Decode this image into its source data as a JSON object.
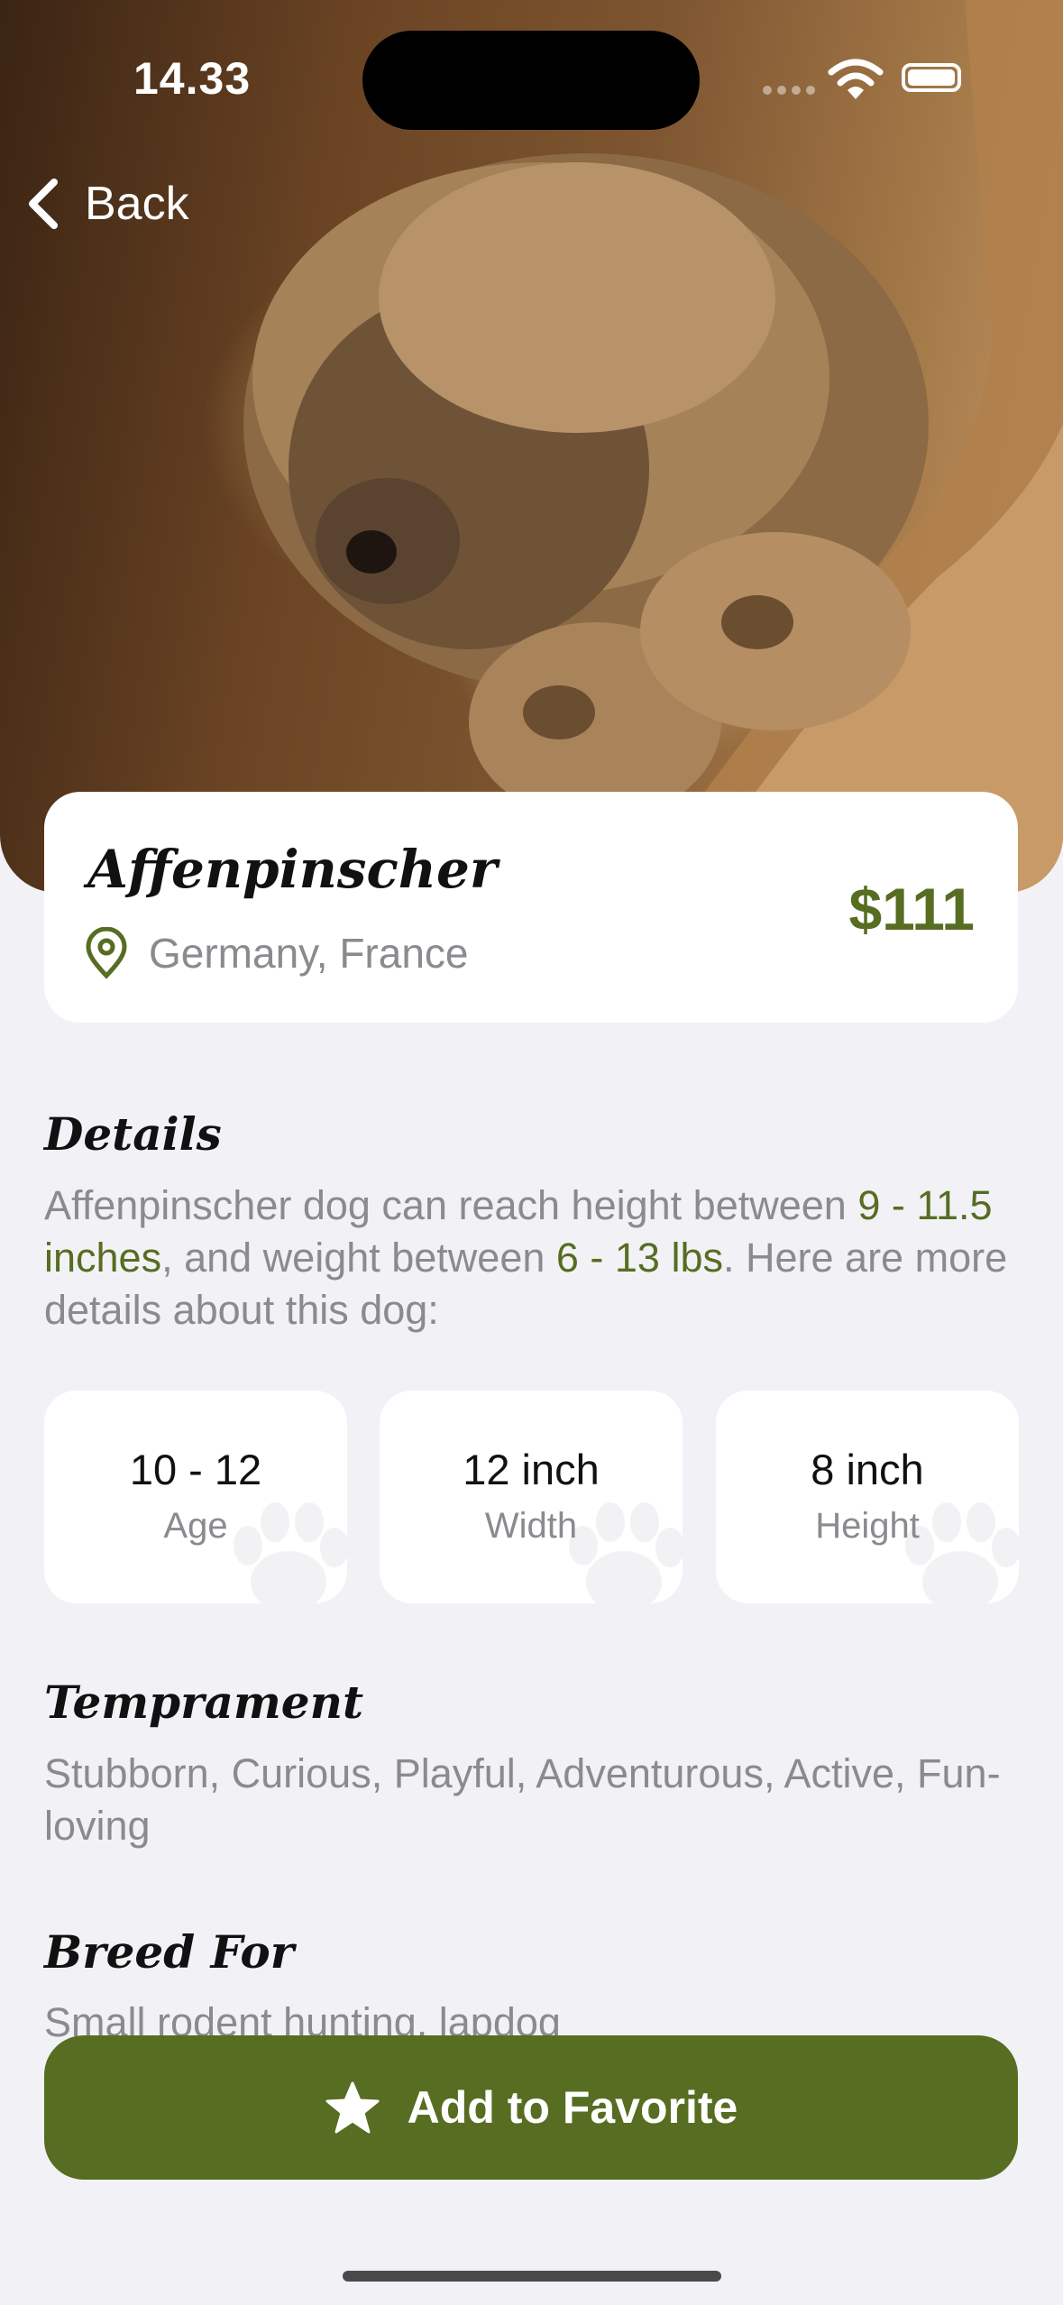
{
  "status_bar": {
    "time": "14.33"
  },
  "nav": {
    "back_label": "Back"
  },
  "breed": {
    "name": "Affenpinscher",
    "origin": "Germany, France",
    "price": "$111"
  },
  "details": {
    "title": "Details",
    "text_1": "Affenpinscher dog can reach height between ",
    "height_range": "9 - 11.5 inches",
    "text_2": ", and weight between ",
    "weight_range": "6 - 13 lbs",
    "text_3": ". Here are more details about this dog:"
  },
  "stats": [
    {
      "value": "10 - 12",
      "label": "Age"
    },
    {
      "value": "12 inch",
      "label": "Width"
    },
    {
      "value": "8 inch",
      "label": "Height"
    }
  ],
  "temperament": {
    "title": "Temprament",
    "text": "Stubborn, Curious, Playful, Adventurous, Active, Fun-loving"
  },
  "breed_for": {
    "title": "Breed For",
    "text": "Small rodent hunting, lapdog"
  },
  "actions": {
    "favorite_label": "Add to Favorite"
  },
  "colors": {
    "accent": "#566d22",
    "background": "#f2f2f6",
    "muted_text": "#8a8a8f"
  },
  "icons": [
    "chevron-left-icon",
    "location-pin-icon",
    "paw-icon",
    "star-icon",
    "wifi-icon",
    "battery-icon"
  ]
}
